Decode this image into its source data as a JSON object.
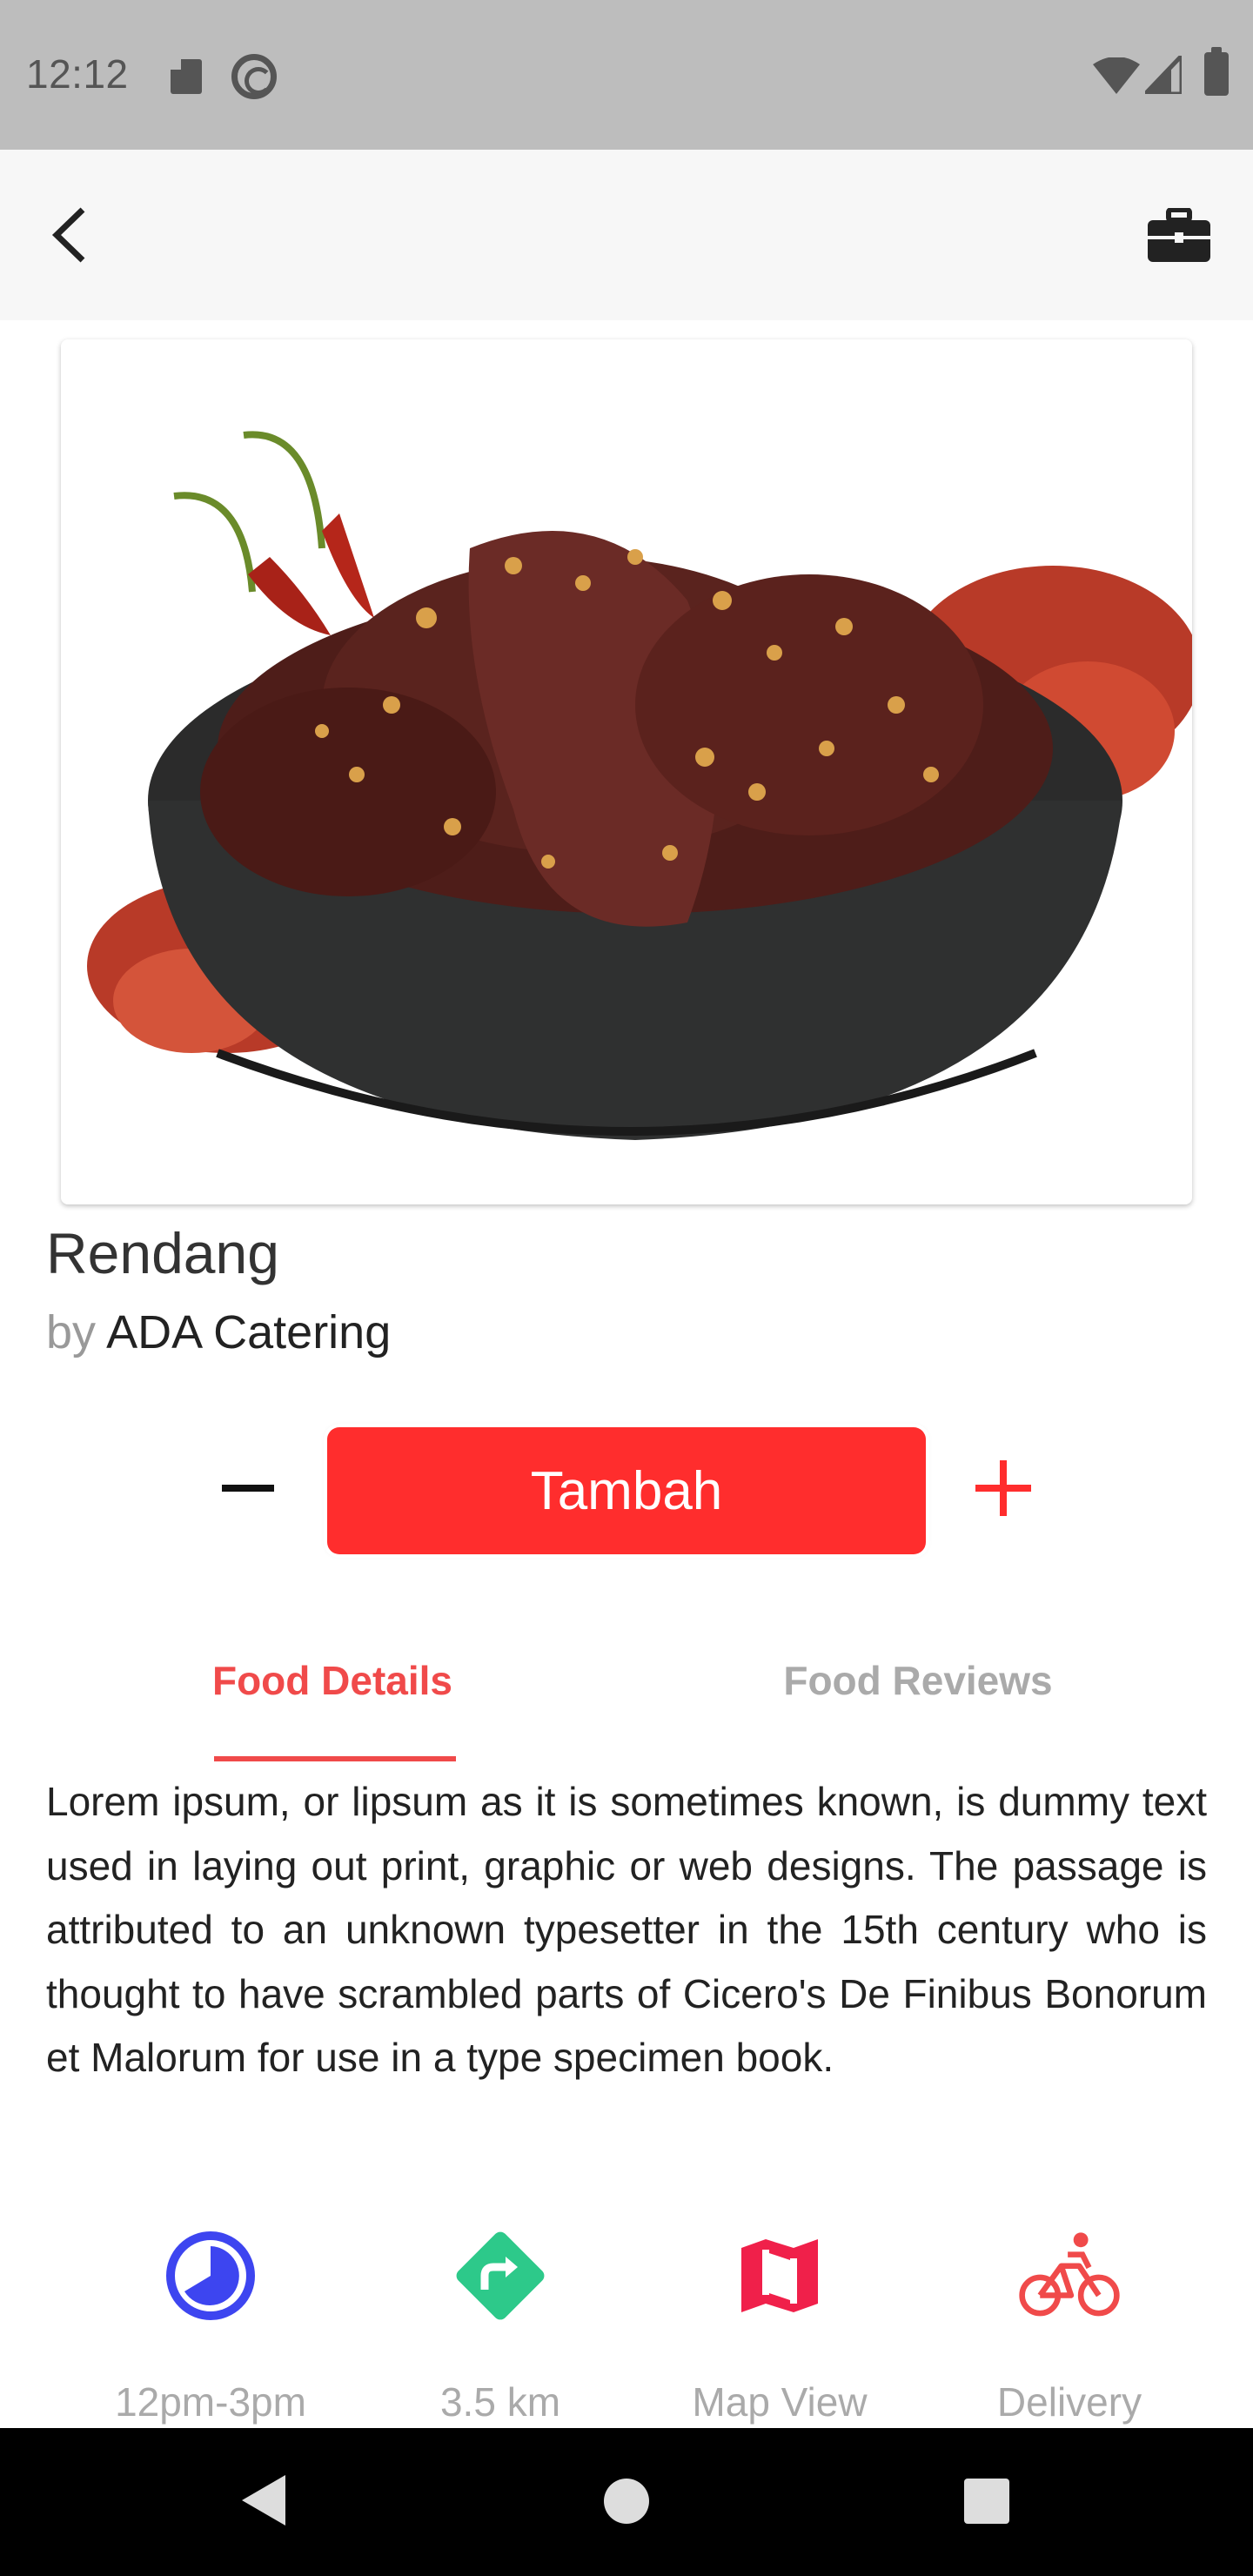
{
  "status_bar": {
    "time": "12:12",
    "icons": [
      "sd-card-icon",
      "at-sign-icon",
      "wifi-icon",
      "signal-icon",
      "battery-icon"
    ]
  },
  "app_bar": {
    "back_icon": "chevron-left-icon",
    "right_icon": "briefcase-icon"
  },
  "food": {
    "name": "Rendang",
    "by_label": "by",
    "vendor": "ADA Catering",
    "image_alt": "bowl of rendang with red chilies"
  },
  "quantity": {
    "minus_icon": "minus-icon",
    "add_label": "Tambah",
    "plus_icon": "plus-icon"
  },
  "tabs": [
    {
      "label": "Food Details",
      "active": true
    },
    {
      "label": "Food Reviews",
      "active": false
    }
  ],
  "description": "Lorem ipsum, or lipsum as it is sometimes known, is dummy text used in laying out print, graphic or web designs. The passage is attributed to an unknown typesetter in the 15th century who is thought to have scrambled parts of Cicero's De Finibus Bonorum et Malorum for use in a type specimen book.",
  "info": [
    {
      "icon": "clock-icon",
      "label": "12pm-3pm",
      "color": "#3d45f0"
    },
    {
      "icon": "directions-icon",
      "label": "3.5 km",
      "color": "#2dc98a"
    },
    {
      "icon": "map-icon",
      "label": "Map View",
      "color": "#f0204a"
    },
    {
      "icon": "bicycle-icon",
      "label": "Delivery",
      "color": "#f04a4a"
    }
  ],
  "colors": {
    "accent": "#ff2d2d",
    "tab_active": "#f04a4a",
    "muted": "#aaaaaa"
  },
  "nav_bar": {
    "icons": [
      "nav-back-icon",
      "nav-home-icon",
      "nav-recents-icon"
    ]
  }
}
